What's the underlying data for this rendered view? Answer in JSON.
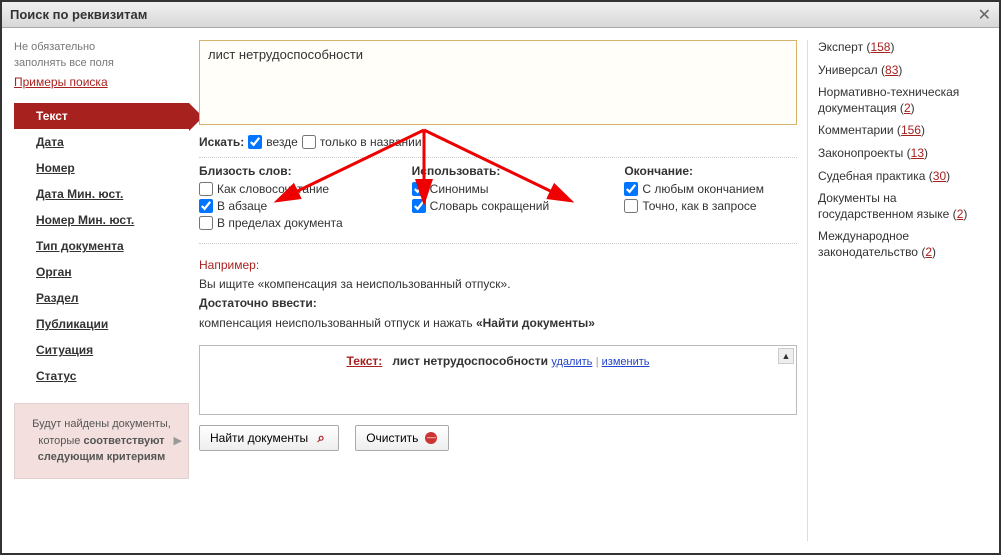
{
  "window": {
    "title": "Поиск по реквизитам"
  },
  "hint": {
    "line1": "Не обязательно",
    "line2": "заполнять все поля",
    "examples": "Примеры поиска"
  },
  "nav": {
    "items": [
      {
        "label": "Текст",
        "active": true
      },
      {
        "label": "Дата"
      },
      {
        "label": "Номер"
      },
      {
        "label": "Дата Мин. юст."
      },
      {
        "label": "Номер Мин. юст."
      },
      {
        "label": "Тип документа"
      },
      {
        "label": "Орган"
      },
      {
        "label": "Раздел"
      },
      {
        "label": "Публикации"
      },
      {
        "label": "Ситуация"
      },
      {
        "label": "Статус"
      }
    ]
  },
  "criteria": {
    "l1": "Будут найдены документы,",
    "l2a": "которые ",
    "l2b": "соответствуют",
    "l3": "следующим критериям"
  },
  "search": {
    "value": "лист нетрудоспособности"
  },
  "options": {
    "search_in_label": "Искать:",
    "everywhere": "везде",
    "title_only": "только в названии",
    "proximity_label": "Близость слов:",
    "as_phrase": "Как словосочетание",
    "in_paragraph": "В абзаце",
    "in_document": "В пределах документа",
    "use_label": "Использовать:",
    "synonyms": "Синонимы",
    "abbrev": "Словарь сокращений",
    "ending_label": "Окончание:",
    "any_ending": "С любым окончанием",
    "exact": "Точно, как в запросе"
  },
  "example": {
    "title": "Например:",
    "line1": "Вы ищите «компенсация за неиспользованный отпуск».",
    "line2_label": "Достаточно ввести:",
    "line2a": "компенсация неиспользованный отпуск и нажать ",
    "line2b": "«Найти документы»"
  },
  "result": {
    "label": "Текст:",
    "text": "лист нетрудоспособности",
    "del": "удалить",
    "edit": "изменить"
  },
  "buttons": {
    "find": "Найти документы",
    "clear": "Очистить"
  },
  "profiles": [
    {
      "name": "Эксперт",
      "count": "158"
    },
    {
      "name": "Универсал",
      "count": "83"
    },
    {
      "name": "Нормативно-техническая документация",
      "count": "2"
    },
    {
      "name": "Комментарии",
      "count": "156"
    },
    {
      "name": "Законопроекты",
      "count": "13"
    },
    {
      "name": "Судебная практика",
      "count": "30"
    },
    {
      "name": "Документы на государственном языке",
      "count": "2"
    },
    {
      "name": "Международное законодательство",
      "count": "2"
    }
  ]
}
